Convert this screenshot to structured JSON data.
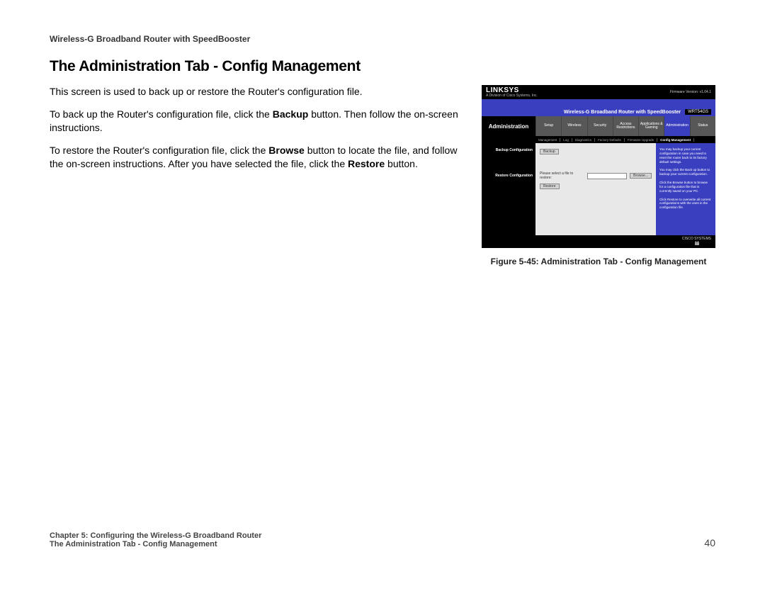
{
  "document": {
    "running_header": "Wireless-G Broadband Router with SpeedBooster",
    "section_title": "The Administration Tab - Config Management",
    "p1": "This screen is used to back up or restore the Router's configuration file.",
    "p2a": "To back up the Router's configuration file, click the ",
    "p2b": "Backup",
    "p2c": " button. Then follow the on-screen instructions.",
    "p3a": "To restore the Router's configuration file, click the ",
    "p3b": "Browse",
    "p3c": " button to locate the file, and follow the on-screen instructions. After you have selected the file, click the ",
    "p3d": "Restore",
    "p3e": " button.",
    "figure_caption": "Figure 5-45: Administration Tab - Config Management",
    "footer_chapter": "Chapter 5: Configuring the Wireless-G Broadband Router",
    "footer_section": "The Administration Tab - Config Management",
    "page_number": "40"
  },
  "router": {
    "logo": "LINKSYS",
    "sublogo": "A Division of Cisco Systems, Inc.",
    "firmware": "Firmware Version: v1.04.1",
    "title": "Wireless-G Broadband Router with SpeedBooster",
    "model": "WRT54GS",
    "side_label": "Administration",
    "tabs": [
      "Setup",
      "Wireless",
      "Security",
      "Access Restrictions",
      "Applications & Gaming",
      "Administration",
      "Status"
    ],
    "subtabs": [
      "Management",
      "Log",
      "Diagnostics",
      "Factory Defaults",
      "Firmware Upgrade",
      "Config Management"
    ],
    "subtab_active": "Config Management",
    "left_sections": [
      "Backup Configuration",
      "Restore Configuration"
    ],
    "backup_btn": "Backup",
    "restore_label": "Please select a file to restore:",
    "browse_btn": "Browse...",
    "restore_btn": "Restore",
    "help1": "You may backup your current configuration in case you need to reset the router back to its factory default settings.",
    "help2": "You may click the Back up button to backup your current configuration.",
    "help3": "Click the Browse button to browse for a configuration file that is currently saved on your PC.",
    "help4": "Click Restore to overwrite all current configurations with the ones in the configuration file.",
    "footer_brand": "CISCO SYSTEMS"
  }
}
